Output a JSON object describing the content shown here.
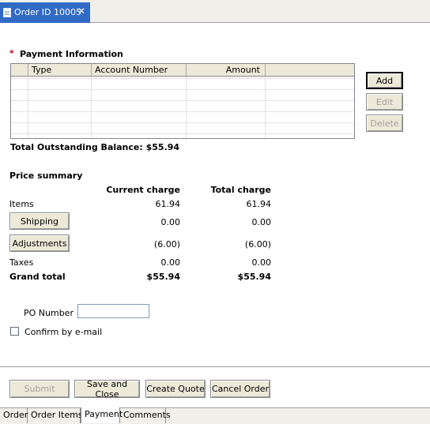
{
  "tab": {
    "title": "Order ID 10005",
    "close": "✕"
  },
  "payment": {
    "required_marker": "*",
    "title": "Payment Information",
    "columns": [
      "Type",
      "Account Number",
      "Amount"
    ],
    "total_outstanding": "Total Outstanding Balance: $55.94",
    "buttons": {
      "add": "Add",
      "edit": "Edit",
      "delete": "Delete"
    }
  },
  "price": {
    "title": "Price summary",
    "col_current": "Current charge",
    "col_total": "Total charge",
    "rows": [
      {
        "label": "Items",
        "current": "61.94",
        "total": "61.94"
      },
      {
        "label": "Shipping",
        "current": "0.00",
        "total": "0.00"
      },
      {
        "label": "Adjustments",
        "current": "(6.00)",
        "total": "(6.00)"
      },
      {
        "label": "Taxes",
        "current": "0.00",
        "total": "0.00"
      },
      {
        "label": "Grand total",
        "current": "$55.94",
        "total": "$55.94"
      }
    ]
  },
  "po": {
    "label": "PO Number",
    "value": ""
  },
  "confirm": {
    "label": "Confirm by e-mail",
    "checked": false
  },
  "actions": {
    "submit": "Submit",
    "save_close": "Save and Close",
    "create_quote": "Create Quote",
    "cancel_order": "Cancel Order"
  },
  "bottom_tabs": [
    "Order",
    "Order Items",
    "Payment",
    "Comments"
  ],
  "active_bottom_tab": "Payment"
}
